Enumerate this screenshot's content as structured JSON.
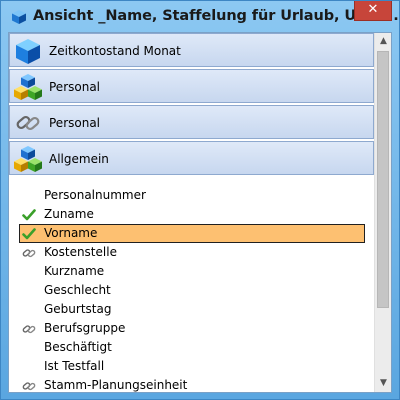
{
  "window": {
    "title": "Ansicht _Name, Staffelung für Urlaub, Urlau..",
    "close_glyph": "✕"
  },
  "sections": [
    {
      "label": "Zeitkontostand Monat",
      "icon": "blue-cube-icon"
    },
    {
      "label": "Personal",
      "icon": "colored-cubes-icon"
    },
    {
      "label": "Personal",
      "icon": "chain-link-icon"
    },
    {
      "label": "Allgemein",
      "icon": "colored-cubes-icon"
    }
  ],
  "fields": [
    {
      "label": "Personalnummer",
      "icon": ""
    },
    {
      "label": "Zuname",
      "icon": "checkmark-icon"
    },
    {
      "label": "Vorname",
      "icon": "checkmark-icon",
      "selected": true
    },
    {
      "label": "Kostenstelle",
      "icon": "chain-link-icon"
    },
    {
      "label": "Kurzname",
      "icon": ""
    },
    {
      "label": "Geschlecht",
      "icon": ""
    },
    {
      "label": "Geburtstag",
      "icon": ""
    },
    {
      "label": "Berufsgruppe",
      "icon": "chain-link-icon"
    },
    {
      "label": "Beschäftigt",
      "icon": ""
    },
    {
      "label": "Ist Testfall",
      "icon": ""
    },
    {
      "label": "Stamm-Planungseinheit",
      "icon": "chain-link-icon"
    }
  ],
  "scrollbar": {
    "up_glyph": "▲",
    "down_glyph": "▼"
  },
  "colors": {
    "selection": "#fdc071",
    "check": "#3aa02a",
    "section_bg": "#d3e0f3"
  }
}
